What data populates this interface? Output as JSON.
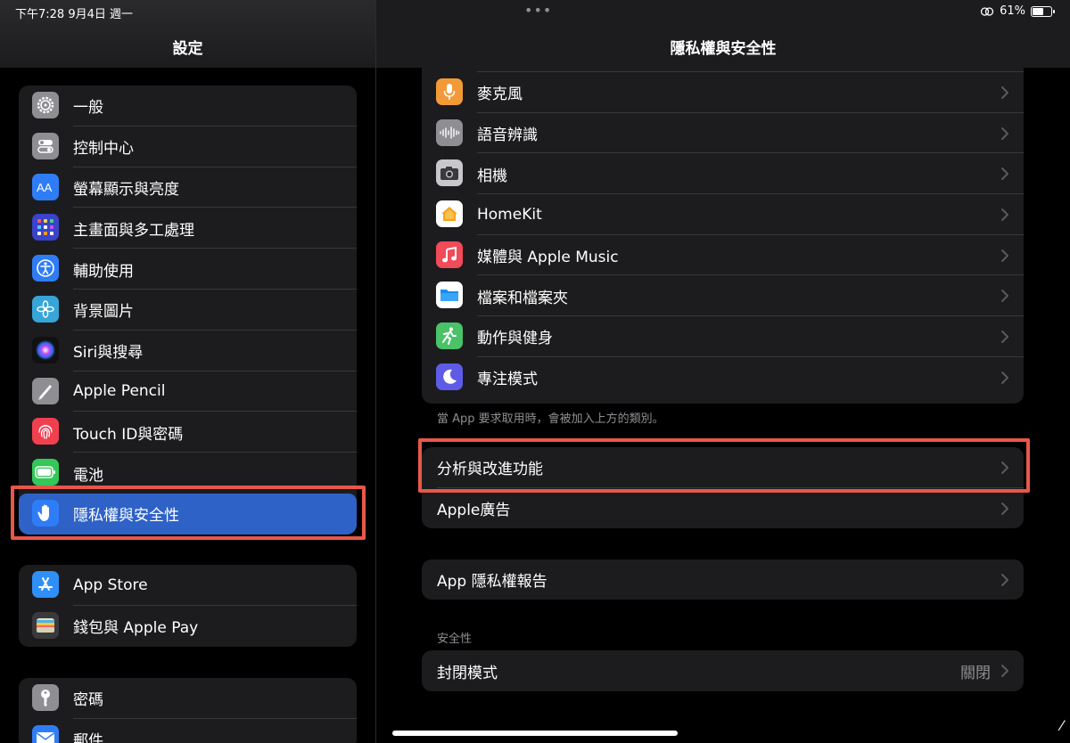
{
  "status": {
    "time_date": "下午7:28   9月4日 週一",
    "battery": "61%",
    "battery_level": 0.61
  },
  "sidebar": {
    "title": "設定",
    "groups": [
      [
        {
          "label": "一般",
          "icon": "gear-icon",
          "color": "#8e8e93"
        },
        {
          "label": "控制中心",
          "icon": "toggle-icon",
          "color": "#8e8e93"
        },
        {
          "label": "螢幕顯示與亮度",
          "icon": "text-size-icon",
          "color": "#2f7df6"
        },
        {
          "label": "主畫面與多工處理",
          "icon": "grid-icon",
          "color": "#3a43c9"
        },
        {
          "label": "輔助使用",
          "icon": "accessibility-icon",
          "color": "#2f7df6"
        },
        {
          "label": "背景圖片",
          "icon": "flower-icon",
          "color": "#37a5d8"
        },
        {
          "label": "Siri與搜尋",
          "icon": "siri-icon",
          "color": "#222"
        },
        {
          "label": "Apple Pencil",
          "icon": "pencil-icon",
          "color": "#8e8e93"
        },
        {
          "label": "Touch ID與密碼",
          "icon": "fingerprint-icon",
          "color": "#f04050"
        },
        {
          "label": "電池",
          "icon": "battery-icon",
          "color": "#34c759"
        },
        {
          "label": "隱私權與安全性",
          "icon": "hand-icon",
          "color": "#2f7df6",
          "selected": true
        }
      ],
      [
        {
          "label": "App Store",
          "icon": "app-store-icon",
          "color": "#2f8ff6"
        },
        {
          "label": "錢包與 Apple Pay",
          "icon": "wallet-icon",
          "color": "#3a3a3c"
        }
      ],
      [
        {
          "label": "密碼",
          "icon": "key-icon",
          "color": "#8e8e93"
        },
        {
          "label": "郵件",
          "icon": "mail-icon",
          "color": "#2f7df6"
        }
      ]
    ]
  },
  "main": {
    "title": "隱私權與安全性",
    "app_rows": [
      {
        "label": "麥克風",
        "icon": "microphone-icon",
        "color": "#f29a38"
      },
      {
        "label": "語音辨識",
        "icon": "waveform-icon",
        "color": "#8e8e93"
      },
      {
        "label": "相機",
        "icon": "camera-icon",
        "color": "#c7c7cc"
      },
      {
        "label": "HomeKit",
        "icon": "home-icon",
        "color": "#ffffff"
      },
      {
        "label": "媒體與 Apple Music",
        "icon": "music-note-icon",
        "color": "#f14a58"
      },
      {
        "label": "檔案和檔案夾",
        "icon": "folder-icon",
        "color": "#ffffff"
      },
      {
        "label": "動作與健身",
        "icon": "running-figure-icon",
        "color": "#4ac267"
      },
      {
        "label": "專注模式",
        "icon": "moon-icon",
        "color": "#5e5ce6"
      }
    ],
    "footnote": "當 App 要求取用時，會被加入上方的類別。",
    "analytics_rows": [
      {
        "label": "分析與改進功能"
      },
      {
        "label": "Apple廣告"
      }
    ],
    "report_row": {
      "label": "App 隱私權報告"
    },
    "security_header": "安全性",
    "lockdown_row": {
      "label": "封閉模式",
      "value": "關閉"
    }
  }
}
